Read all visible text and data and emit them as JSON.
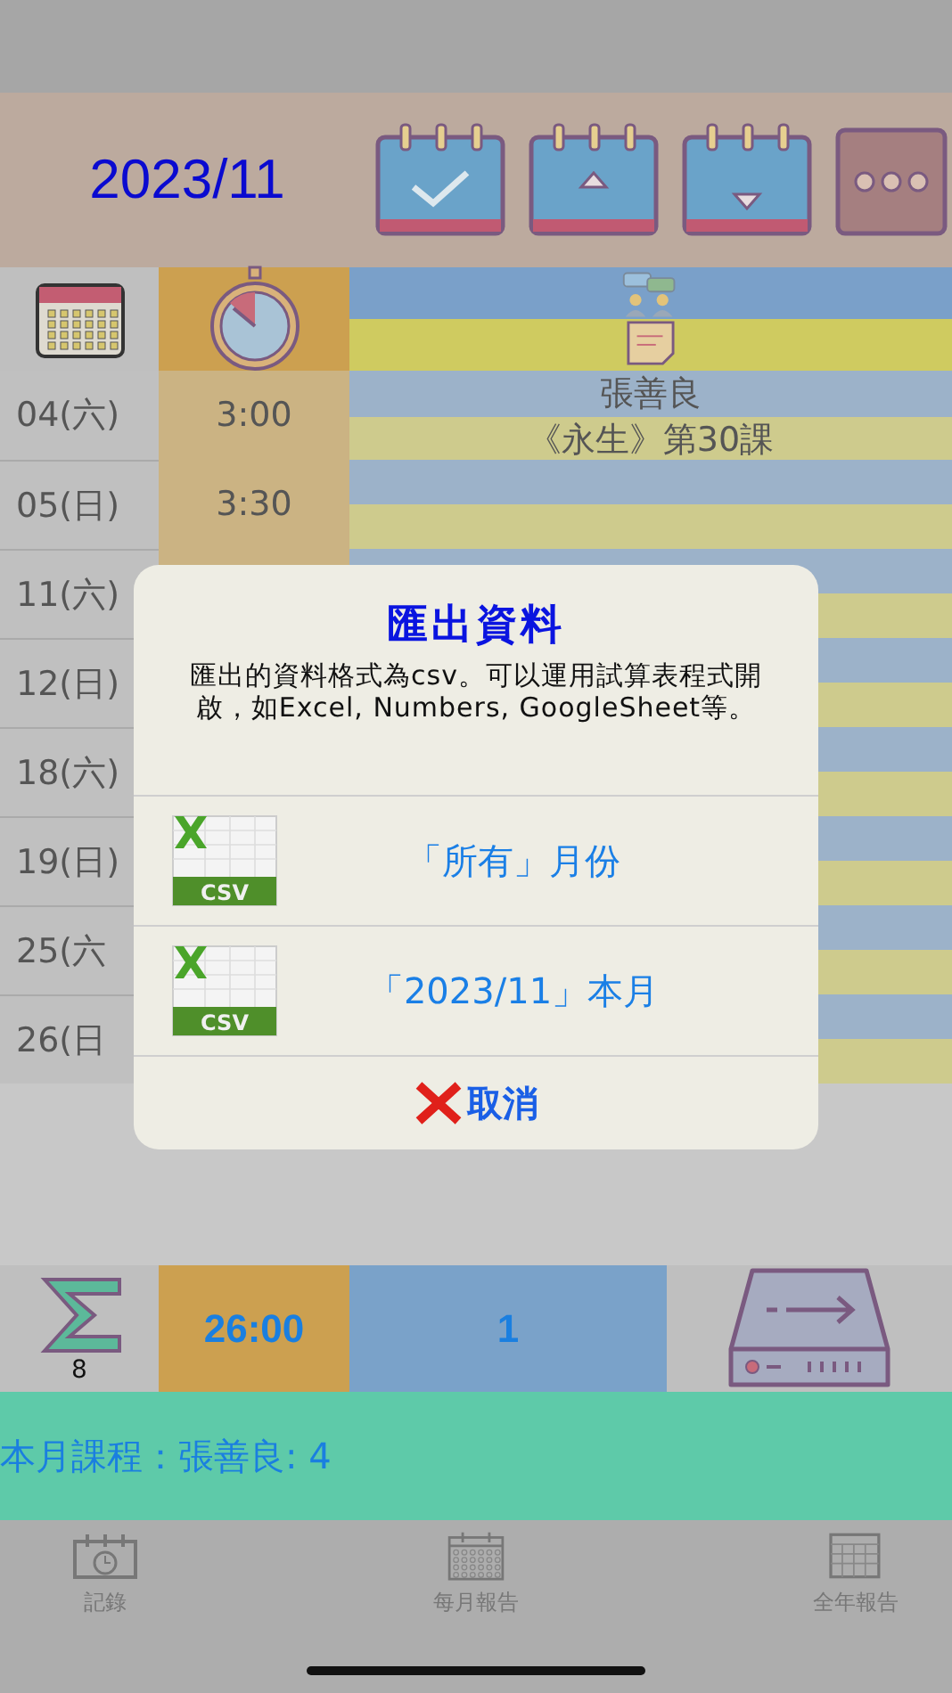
{
  "header": {
    "month": "2023/11"
  },
  "rows": [
    {
      "date": "04(六)",
      "time": "3:00",
      "name": "張善良",
      "course": "《永生》第30課"
    },
    {
      "date": "05(日)",
      "time": "3:30"
    },
    {
      "date": "11(六)"
    },
    {
      "date": "12(日)"
    },
    {
      "date": "18(六)"
    },
    {
      "date": "19(日)"
    },
    {
      "date": "25(六"
    },
    {
      "date": "26(日"
    }
  ],
  "summary": {
    "count": "8",
    "total_time": "26:00",
    "sessions": "1"
  },
  "course_summary": "本月課程：張善良: 4",
  "tabs": [
    {
      "label": "記錄",
      "kind": "record"
    },
    {
      "label": "每月報告",
      "kind": "month"
    },
    {
      "label": "全年報告",
      "kind": "year"
    }
  ],
  "dialog": {
    "title": "匯出資料",
    "message": "匯出的資料格式為csv。可以運用試算表程式開啟，如Excel, Numbers, GoogleSheet等。",
    "options": [
      {
        "label": "「所有」月份",
        "icon_label": "CSV"
      },
      {
        "label": "「2023/11」本月",
        "icon_label": "CSV"
      }
    ],
    "cancel": "取消"
  }
}
